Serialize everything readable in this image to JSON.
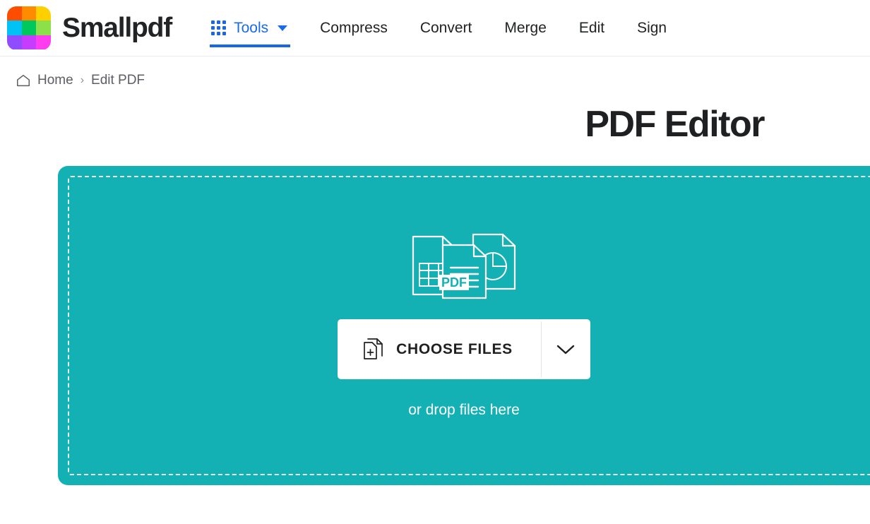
{
  "header": {
    "brand_name": "Smallpdf",
    "logo_colors": [
      "#ff4d00",
      "#ff8c00",
      "#ffd000",
      "#00c2f5",
      "#00c85c",
      "#8ce04a",
      "#8f4dff",
      "#c73dff",
      "#ff3df0"
    ],
    "logo_icon": "smallpdf-logo-icon",
    "nav": [
      {
        "label": "Tools",
        "icon": "apps-grid-icon",
        "active": true,
        "has_caret": true,
        "color": "#1a6aec"
      },
      {
        "label": "Compress",
        "active": false
      },
      {
        "label": "Convert",
        "active": false
      },
      {
        "label": "Merge",
        "active": false
      },
      {
        "label": "Edit",
        "active": false
      },
      {
        "label": "Sign",
        "active": false
      }
    ],
    "accent_color": "#1a66e8"
  },
  "breadcrumb": {
    "home_icon": "home-icon",
    "home_label": "Home",
    "separator": "›",
    "current_label": "Edit PDF"
  },
  "main": {
    "title": "PDF Editor",
    "dropzone": {
      "background_color": "#13b1b4",
      "illustration_icon": "pdf-documents-illustration",
      "pdf_badge_label": "PDF",
      "choose_files_label": "CHOOSE FILES",
      "choose_files_icon": "add-file-icon",
      "dropdown_icon": "chevron-down-icon",
      "drop_hint": "or drop files here"
    }
  }
}
